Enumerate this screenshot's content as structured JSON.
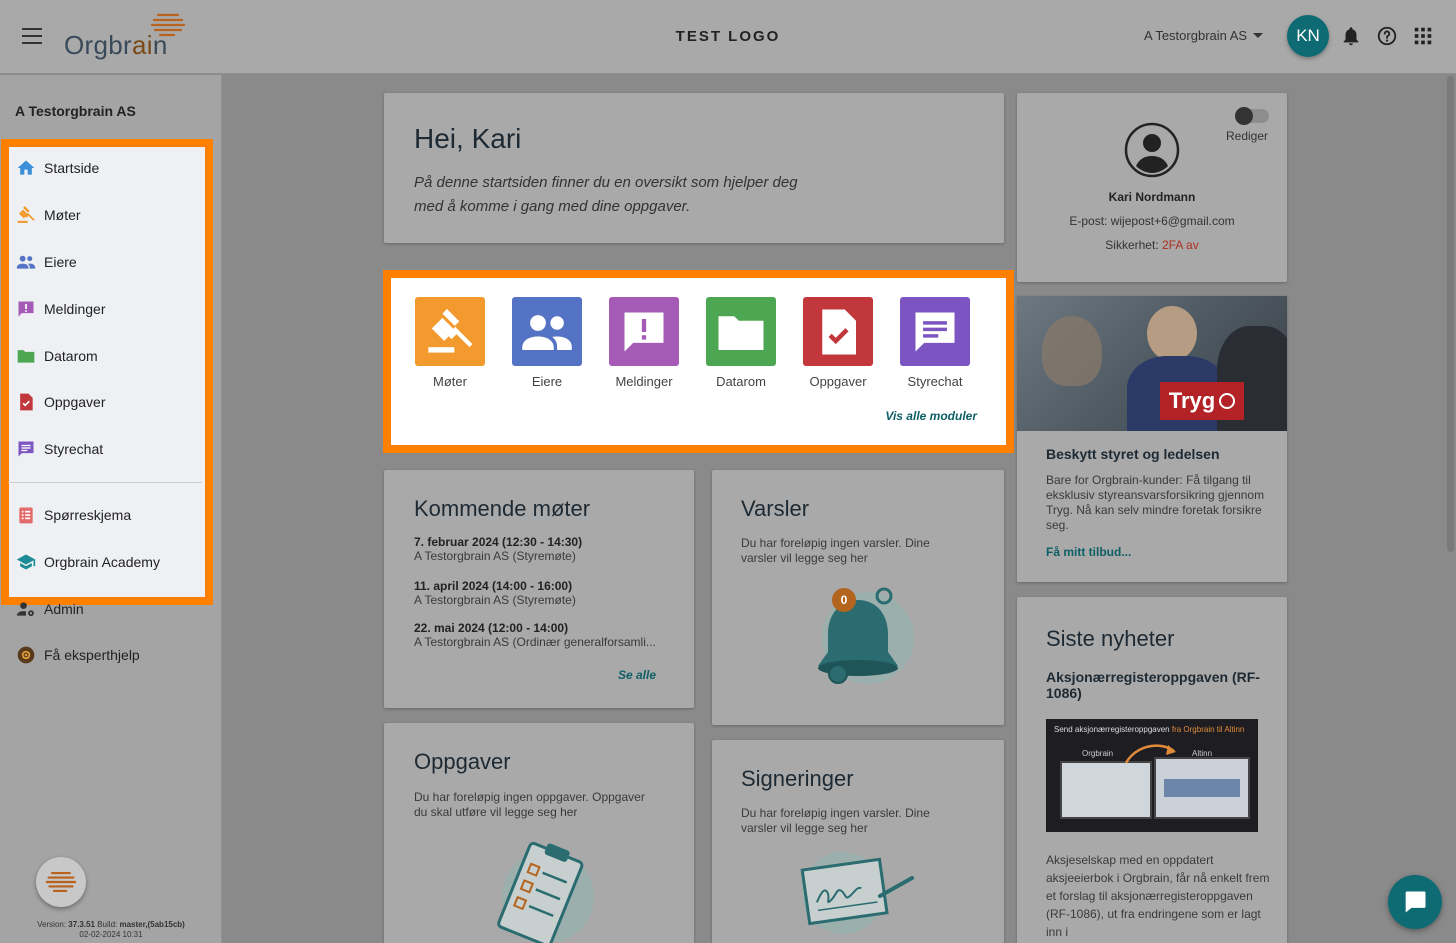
{
  "topbar": {
    "logo_text_start": "Orgbr",
    "logo_text_ai": "ai",
    "logo_text_end": "n",
    "center_logo": "TEST LOGO",
    "company": "A Testorgbrain AS",
    "avatar_initials": "KN"
  },
  "sidebar": {
    "company": "A Testorgbrain AS",
    "items": [
      {
        "label": "Startside",
        "icon": "home-icon",
        "color": "#3a8fd8"
      },
      {
        "label": "Møter",
        "icon": "gavel-icon",
        "color": "#f29a2e"
      },
      {
        "label": "Eiere",
        "icon": "people-icon",
        "color": "#5473c4"
      },
      {
        "label": "Meldinger",
        "icon": "message-alert-icon",
        "color": "#a55bb5"
      },
      {
        "label": "Datarom",
        "icon": "folder-icon",
        "color": "#4da651"
      },
      {
        "label": "Oppgaver",
        "icon": "task-icon",
        "color": "#c1373b"
      },
      {
        "label": "Styrechat",
        "icon": "chat-icon",
        "color": "#7d55c3"
      },
      {
        "label": "Spørreskjema",
        "icon": "survey-icon",
        "color": "#e36b6b"
      },
      {
        "label": "Orgbrain Academy",
        "icon": "academy-icon",
        "color": "#1b8c95"
      },
      {
        "label": "Admin",
        "icon": "admin-icon",
        "color": "#333333"
      },
      {
        "label": "Få eksperthjelp",
        "icon": "expert-icon",
        "color": "#5a3a1a"
      }
    ],
    "version_line1_prefix": "Version: ",
    "version_number": "37.3.51",
    "version_build_prefix": " Build: ",
    "version_build": "master,(5ab15cb)",
    "version_date": "02-02-2024 10:31"
  },
  "welcome": {
    "title": "Hei, Kari",
    "line1": "På denne startsiden finner du en oversikt som hjelper deg",
    "line2": "med å komme i gang med dine oppgaver."
  },
  "modules": {
    "items": [
      {
        "label": "Møter",
        "color": "#f29a2e"
      },
      {
        "label": "Eiere",
        "color": "#5473c4"
      },
      {
        "label": "Meldinger",
        "color": "#a55bb5"
      },
      {
        "label": "Datarom",
        "color": "#4da651"
      },
      {
        "label": "Oppgaver",
        "color": "#c1373b"
      },
      {
        "label": "Styrechat",
        "color": "#7d55c3"
      }
    ],
    "see_all": "Vis alle moduler"
  },
  "profile": {
    "edit_label": "Rediger",
    "name": "Kari Nordmann",
    "email_label": "E-post: ",
    "email": "wijepost+6@gmail.com",
    "security_label": "Sikkerhet: ",
    "security_value": "2FA av"
  },
  "insurance": {
    "brand": "Tryg",
    "title": "Beskytt styret og ledelsen",
    "text": "Bare for Orgbrain-kunder: Få tilgang til eksklusiv styreansvarsforsikring gjennom Tryg. Nå kan selv mindre foretak forsikre seg.",
    "cta": "Få mitt tilbud..."
  },
  "meetings": {
    "title": "Kommende møter",
    "items": [
      {
        "date": "7. februar 2024 (12:30 - 14:30)",
        "org": "A Testorgbrain AS (Styremøte)"
      },
      {
        "date": "11. april 2024 (14:00 - 16:00)",
        "org": "A Testorgbrain AS (Styremøte)"
      },
      {
        "date": "22. mai 2024 (12:00 - 14:00)",
        "org": "A Testorgbrain AS (Ordinær generalforsamli..."
      }
    ],
    "see_all": "Se alle"
  },
  "alerts": {
    "title": "Varsler",
    "text": "Du har foreløpig ingen varsler. Dine varsler vil legge seg her",
    "badge_count": "0"
  },
  "tasks": {
    "title": "Oppgaver",
    "text": "Du har foreløpig ingen oppgaver. Oppgaver du skal utføre vil legge seg her"
  },
  "signatures": {
    "title": "Signeringer",
    "text": "Du har foreløpig ingen varsler. Dine varsler vil legge seg her"
  },
  "news": {
    "title": "Siste nyheter",
    "headline": "Aksjonærregisteroppgaven (RF-1086)",
    "img_caption_start": "Send aksjonærregisteroppgaven ",
    "img_caption_highlight": "fra Orgbrain til Altinn",
    "img_left_brand": "Orgbrain",
    "img_right_brand": "Altinn",
    "body": "Aksjeselskap med en oppdatert aksjeeierbok i Orgbrain, får nå enkelt frem et forslag til aksjonærregisteroppgaven (RF-1086), ut fra endringene som er lagt inn i"
  }
}
